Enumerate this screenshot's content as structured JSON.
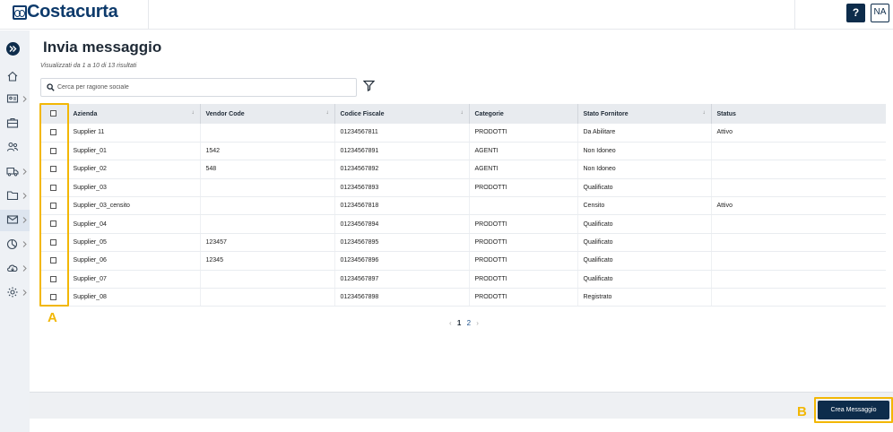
{
  "header": {
    "logo_text": "Costacurta",
    "help_label": "?",
    "avatar_initials": "NA"
  },
  "page": {
    "title": "Invia messaggio",
    "subtitle": "Visualizzati da 1 a 10 di 13 risultati"
  },
  "search": {
    "placeholder": "Cerca per ragione sociale",
    "value": ""
  },
  "table": {
    "columns": [
      "Azienda",
      "Vendor Code",
      "Codice Fiscale",
      "Categorie",
      "Stato Fornitore",
      "Status"
    ],
    "rows": [
      {
        "azienda": "Supplier 11",
        "vendor": "",
        "cf": "01234567811",
        "cat": "PRODOTTI",
        "stato": "Da Abilitare",
        "status": "Attivo"
      },
      {
        "azienda": "Supplier_01",
        "vendor": "1542",
        "cf": "01234567891",
        "cat": "AGENTI",
        "stato": "Non Idoneo",
        "status": ""
      },
      {
        "azienda": "Supplier_02",
        "vendor": "548",
        "cf": "01234567892",
        "cat": "AGENTI",
        "stato": "Non Idoneo",
        "status": ""
      },
      {
        "azienda": "Supplier_03",
        "vendor": "",
        "cf": "01234567893",
        "cat": "PRODOTTI",
        "stato": "Qualificato",
        "status": ""
      },
      {
        "azienda": "Supplier_03_censito",
        "vendor": "",
        "cf": "01234567818",
        "cat": "",
        "stato": "Censito",
        "status": "Attivo"
      },
      {
        "azienda": "Supplier_04",
        "vendor": "",
        "cf": "01234567894",
        "cat": "PRODOTTI",
        "stato": "Qualificato",
        "status": ""
      },
      {
        "azienda": "Supplier_05",
        "vendor": "123457",
        "cf": "01234567895",
        "cat": "PRODOTTI",
        "stato": "Qualificato",
        "status": ""
      },
      {
        "azienda": "Supplier_06",
        "vendor": "12345",
        "cf": "01234567896",
        "cat": "PRODOTTI",
        "stato": "Qualificato",
        "status": ""
      },
      {
        "azienda": "Supplier_07",
        "vendor": "",
        "cf": "01234567897",
        "cat": "PRODOTTI",
        "stato": "Qualificato",
        "status": ""
      },
      {
        "azienda": "Supplier_08",
        "vendor": "",
        "cf": "01234567898",
        "cat": "PRODOTTI",
        "stato": "Registrato",
        "status": ""
      }
    ]
  },
  "pagination": {
    "pages": [
      "1",
      "2"
    ],
    "prev": "‹",
    "next": "›"
  },
  "annotations": {
    "a": "A",
    "b": "B"
  },
  "footer": {
    "crea_label": "Crea Messaggio"
  },
  "colors": {
    "brand": "#0d3a6b",
    "primary_button": "#0d2c4b",
    "highlight": "#f2b705",
    "category_link": "#1a4f8a"
  }
}
